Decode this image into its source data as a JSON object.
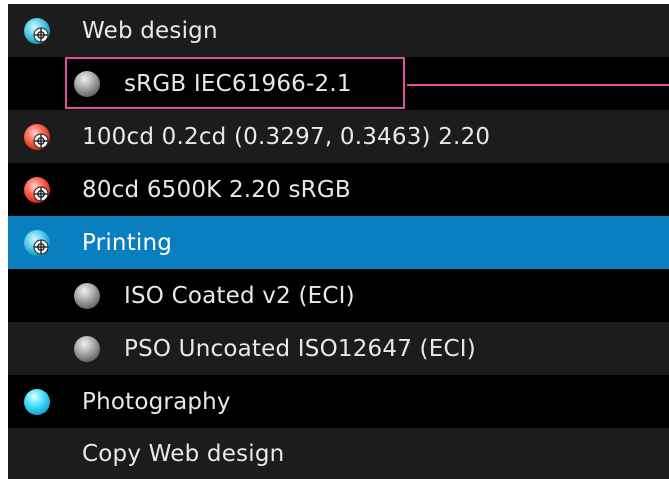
{
  "profiles": [
    {
      "label": "Web design",
      "level": 0,
      "icon": "globe-blue-crosshair-icon",
      "selected": false
    },
    {
      "label": "sRGB IEC61966-2.1",
      "level": 1,
      "icon": "grey-ball-icon",
      "selected": false,
      "highlighted": true
    },
    {
      "label": "100cd 0.2cd  (0.3297, 0.3463) 2.20",
      "level": 0,
      "icon": "globe-red-crosshair-icon",
      "selected": false
    },
    {
      "label": "80cd 6500K 2.20 sRGB",
      "level": 0,
      "icon": "globe-red-crosshair-icon",
      "selected": false
    },
    {
      "label": "Printing",
      "level": 0,
      "icon": "globe-blue-crosshair-icon",
      "selected": true
    },
    {
      "label": "ISO Coated v2 (ECI)",
      "level": 1,
      "icon": "grey-ball-icon",
      "selected": false
    },
    {
      "label": "PSO Uncoated ISO12647 (ECI)",
      "level": 1,
      "icon": "grey-ball-icon",
      "selected": false
    },
    {
      "label": "Photography",
      "level": 0,
      "icon": "cyan-ball-icon",
      "selected": false
    },
    {
      "label": "Copy Web design",
      "level": 0,
      "icon": "",
      "selected": false
    }
  ],
  "colors": {
    "selected_row": "#0a7fc0",
    "highlight": "#e14f9a",
    "row_alt": "#1c1c1c",
    "row_dark": "#000000",
    "text": "#e8e8e8"
  }
}
